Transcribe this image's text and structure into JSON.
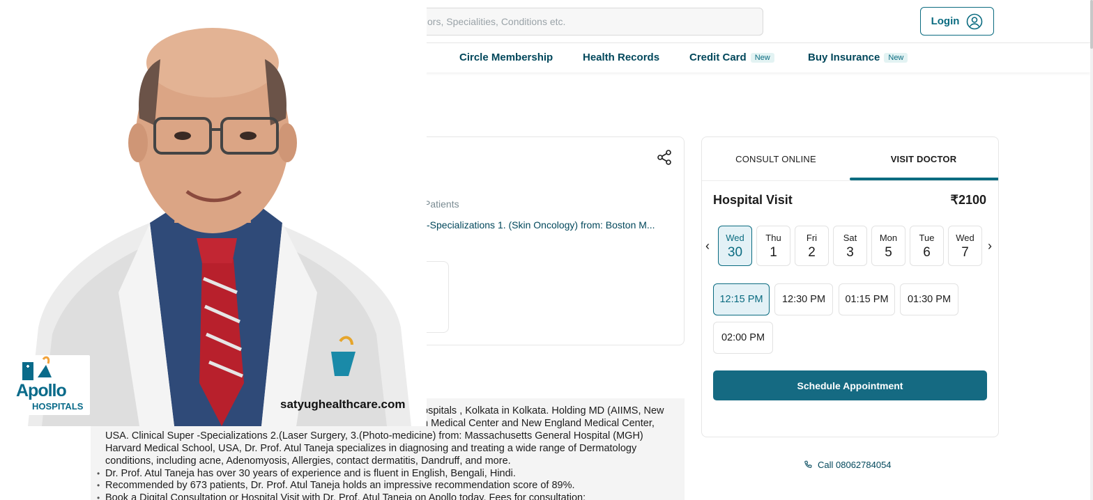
{
  "header": {
    "search_placeholder": "ors, Specialities, Conditions etc.",
    "login_label": "Login"
  },
  "nav": {
    "items": [
      {
        "label": "Circle Membership",
        "badge": ""
      },
      {
        "label": "Health Records",
        "badge": ""
      },
      {
        "label": "Credit Card",
        "badge": "New"
      },
      {
        "label": "Buy Insurance",
        "badge": "New"
      }
    ]
  },
  "profile": {
    "patients_text": "Patients",
    "specialization_text": "-Specializations 1. (Skin Oncology) from: Boston M..."
  },
  "about": {
    "line1": "ospitals , Kolkata in Kolkata. Holding MD (AIIMS, New",
    "line2": "n Medical Center and New England Medical Center,",
    "line3": "USA. Clinical Super -Specializations 2.(Laser Surgery, 3.(Photo-medicine) from: Massachusetts General Hospital (MGH)",
    "line4": "Harvard Medical School, USA, Dr. Prof. Atul Taneja specializes in diagnosing and treating a wide range of Dermatology",
    "line5": "conditions, including acne, Adenomyosis, Allergies, contact dermatitis, Dandruff, and more.",
    "bullet2": "Dr. Prof. Atul Taneja has over 30 years of experience and is fluent in English, Bengali, Hindi.",
    "bullet3": "Recommended by 673 patients, Dr. Prof. Atul Taneja holds an impressive recommendation score of 89%.",
    "bullet4": "Book a Digital Consultation or Hospital Visit with Dr. Prof. Atul Taneja on Apollo today. Fees for consultation:"
  },
  "booking": {
    "tabs": [
      "CONSULT ONLINE",
      "VISIT DOCTOR"
    ],
    "active_tab": "VISIT DOCTOR",
    "title": "Hospital Visit",
    "price": "₹2100",
    "days": [
      {
        "name": "Wed",
        "date": "30"
      },
      {
        "name": "Thu",
        "date": "1"
      },
      {
        "name": "Fri",
        "date": "2"
      },
      {
        "name": "Sat",
        "date": "3"
      },
      {
        "name": "Mon",
        "date": "5"
      },
      {
        "name": "Tue",
        "date": "6"
      },
      {
        "name": "Wed",
        "date": "7"
      }
    ],
    "selected_day": "Wed 30",
    "slots": [
      "12:15 PM",
      "12:30 PM",
      "01:15 PM",
      "01:30 PM",
      "02:00 PM"
    ],
    "selected_slot": "12:15 PM",
    "schedule_label": "Schedule Appointment",
    "prev_icon": "chevron-left-icon",
    "next_icon": "chevron-right-icon"
  },
  "call": {
    "label": "Call 08062784054",
    "icon": "phone-icon"
  },
  "overlay": {
    "logo_text": "Apollo",
    "logo_subtext": "HOSPITALS",
    "watermark": "satyughealthcare.com"
  },
  "colors": {
    "brand": "#0a6b80",
    "button": "#156a82",
    "selected_bg": "#e3f1f6",
    "text_dark": "#01475b"
  }
}
